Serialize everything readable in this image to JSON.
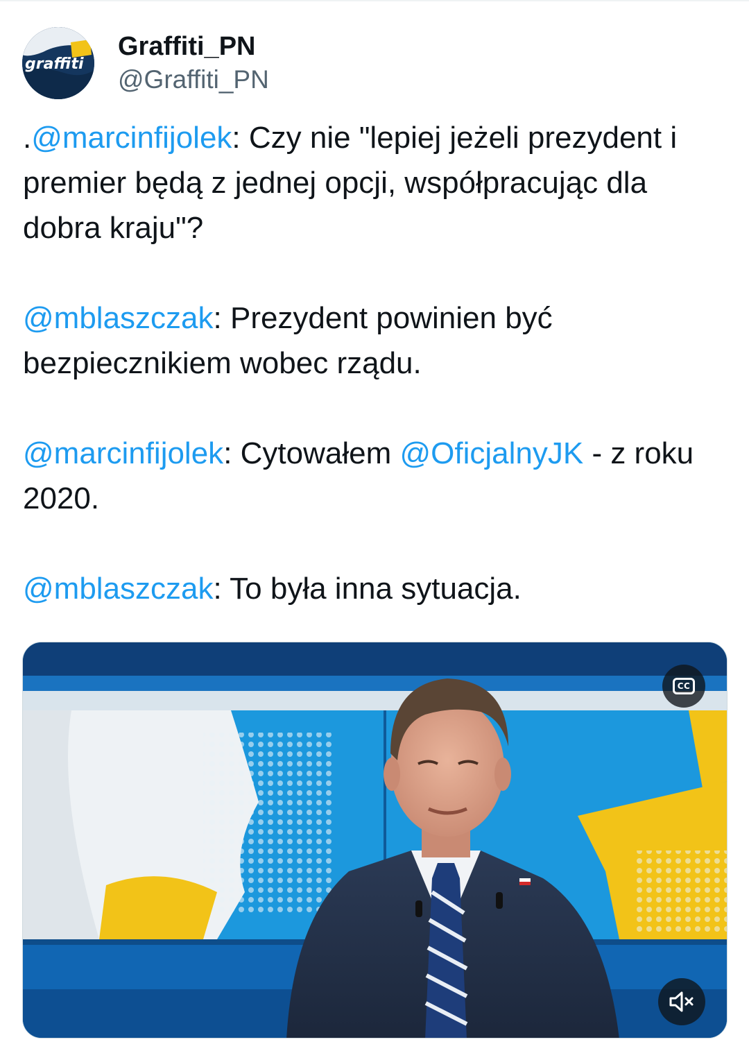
{
  "author": {
    "display_name": "Graffiti_PN",
    "handle": "@Graffiti_PN",
    "avatar_text": "graffiti"
  },
  "tweet": {
    "line1_prefix": ".",
    "mention_marcin": "@marcinfijolek",
    "line1_text": ": Czy nie \"lepiej jeżeli prezydent i premier będą z jednej opcji, współpracując dla dobra kraju\"?",
    "mention_mblaszczak": "@mblaszczak",
    "line2_text": ": Prezydent powinien być bezpiecznikiem wobec rządu.",
    "line3_text_a": ": Cytowałem ",
    "mention_oficjalny": "@OficjalnyJK",
    "line3_text_b": " - z roku 2020.",
    "line4_text": ": To była inna sytuacja."
  },
  "media": {
    "cc_label": "CC",
    "cc_icon": "closed-captions-icon",
    "mute_icon": "speaker-muted-icon"
  },
  "colors": {
    "link": "#1d9bf0",
    "text": "#0f1419",
    "secondary": "#536471",
    "studio_blue": "#1a8fd6",
    "studio_yellow": "#f2c318"
  }
}
